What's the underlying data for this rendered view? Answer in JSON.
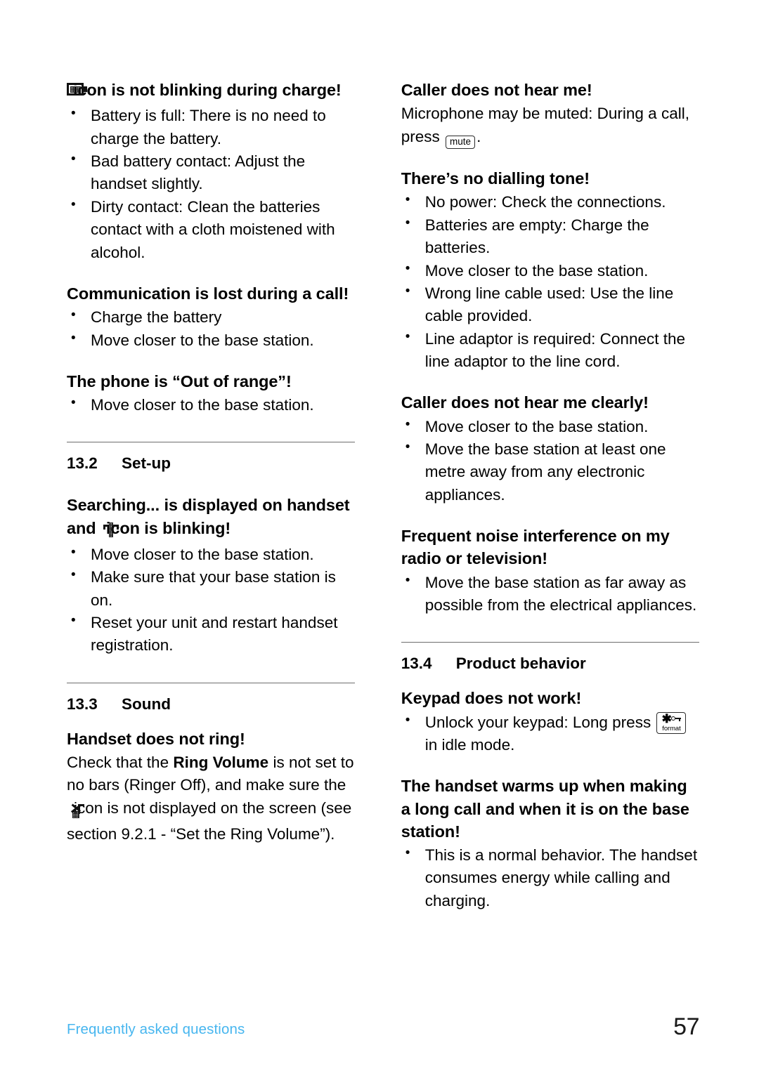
{
  "page": {
    "number": "57",
    "footer_label": "Frequently asked questions",
    "accent_color": "#47b6ef"
  },
  "left_column": {
    "blocks": [
      {
        "type": "heading_with_icon",
        "icon": "battery-icon",
        "heading_text": "icon is not blinking during charge!",
        "bullets": [
          "Battery is full: There is no need to charge the battery.",
          "Bad battery contact: Adjust the handset slightly.",
          "Dirty contact: Clean the batteries contact with a cloth moistened with alcohol."
        ]
      },
      {
        "type": "heading",
        "heading_text": "Communication is lost during a call!",
        "bullets": [
          "Charge the battery",
          "Move closer to the base station."
        ]
      },
      {
        "type": "heading",
        "heading_text": "The phone is “Out of range”!",
        "bullets": [
          "Move closer to the base station."
        ]
      }
    ],
    "section_1": {
      "number": "13.2",
      "title": "Set-up",
      "heading_part1": "Searching... is displayed on handset and",
      "icon": "antenna-icon",
      "heading_part2": "icon is blinking!",
      "bullets": [
        "Move closer to the base station.",
        "Make sure that your base station is on.",
        "Reset your unit and restart handset registration."
      ]
    },
    "section_2": {
      "number": "13.3",
      "title": "Sound",
      "heading": "Handset does not ring!",
      "paragraph_part1": "Check that the ",
      "paragraph_bold": "Ring Volume",
      "paragraph_part2": " is not set to no bars (Ringer Off), and make sure the ",
      "icon": "ringer-off-icon",
      "paragraph_part3": " icon is not displayed on the screen (see section 9.2.1 - “Set the Ring Volume”)."
    }
  },
  "right_column": {
    "blocks": [
      {
        "type": "heading_paragraph",
        "heading_text": "Caller does not hear me!",
        "paragraph_part1": "Microphone may be muted: During a call, press ",
        "key_label": "mute",
        "paragraph_part2": "."
      },
      {
        "type": "heading",
        "heading_text": "There’s no dialling tone!",
        "bullets": [
          "No power: Check the connections.",
          "Batteries are empty: Charge the batteries.",
          "Move closer to the base station.",
          "Wrong line cable used: Use the line cable provided.",
          "Line adaptor is required: Connect the line adaptor to the line cord."
        ]
      },
      {
        "type": "heading",
        "heading_text": "Caller does not hear me clearly!",
        "bullets": [
          "Move closer to the base station.",
          "Move the base station at least one metre away from any electronic appliances."
        ]
      },
      {
        "type": "heading",
        "heading_text": "Frequent noise interference on my radio or television!",
        "bullets": [
          "Move the base station as far away as possible from the electrical appliances."
        ]
      }
    ],
    "section_1": {
      "number": "13.4",
      "title": "Product behavior",
      "heading": "Keypad does not work!",
      "bullet_part1": "Unlock your keypad: Long press ",
      "key_label": "format",
      "bullet_part2": " in idle mode."
    },
    "final_block": {
      "heading_text": "The handset warms up when making a long call and when it is on the base station!",
      "bullets": [
        "This is a normal behavior. The handset consumes energy while calling and charging."
      ]
    }
  }
}
